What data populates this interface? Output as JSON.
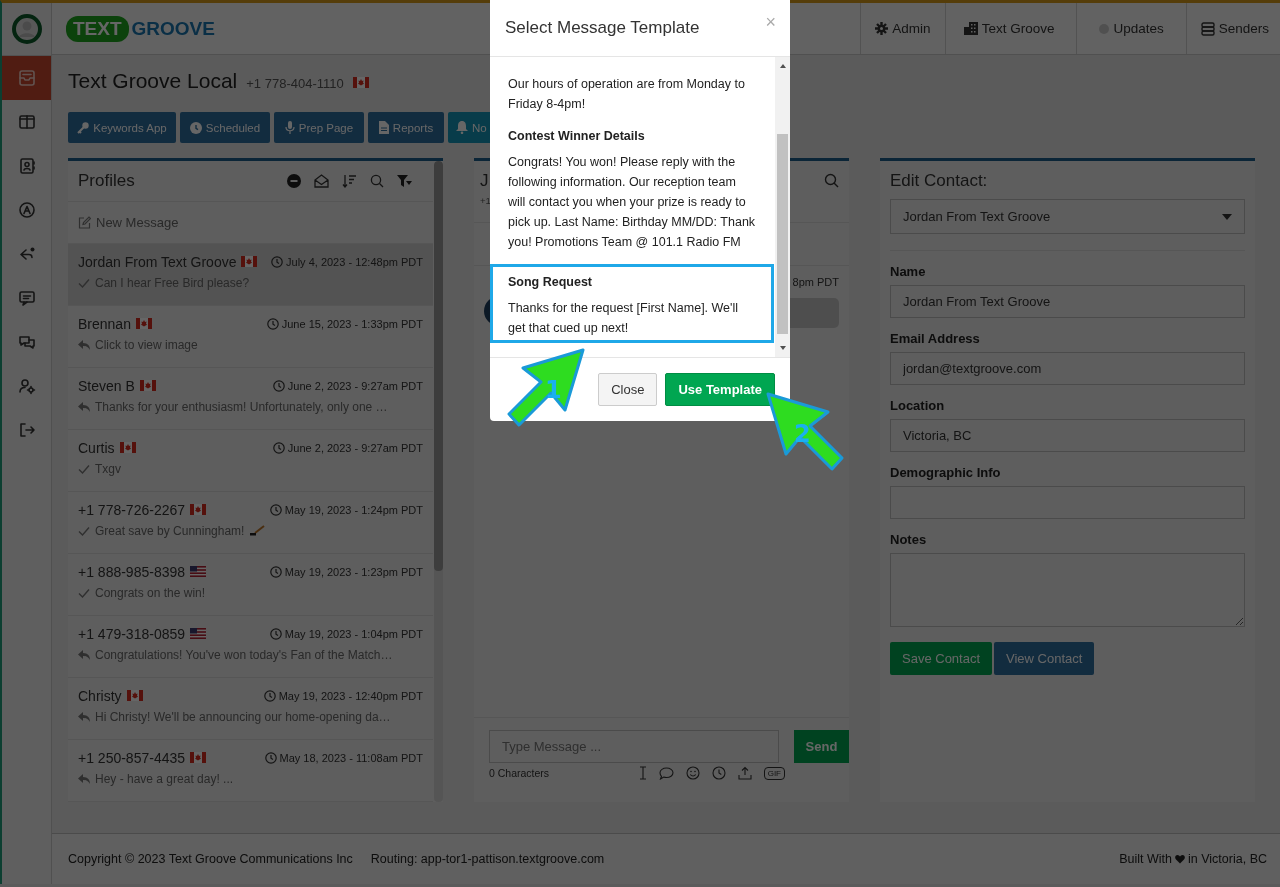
{
  "header": {
    "logo_badge": "TEXT",
    "logo_word": "GROOVE",
    "nav": [
      {
        "label": "Admin",
        "kind": "gear"
      },
      {
        "label": "Text Groove",
        "kind": "building"
      },
      {
        "label": "Updates",
        "kind": "dot"
      },
      {
        "label": "Senders",
        "kind": "stack"
      }
    ]
  },
  "sidebar": {
    "items": [
      {
        "kind": "inbox",
        "selected": true
      },
      {
        "kind": "columns",
        "selected": false
      },
      {
        "kind": "contact",
        "selected": false
      },
      {
        "kind": "compass",
        "selected": false
      },
      {
        "kind": "share",
        "selected": false
      },
      {
        "kind": "chat",
        "selected": false
      },
      {
        "kind": "chats",
        "selected": false
      },
      {
        "kind": "usergear",
        "selected": false
      },
      {
        "kind": "logout",
        "selected": false
      }
    ]
  },
  "page": {
    "title": "Text Groove Local",
    "phone": "+1 778-404-1110",
    "flag": {
      "kind": "ca"
    }
  },
  "toolbar": [
    {
      "label": "Keywords App",
      "kind": "key"
    },
    {
      "label": "Scheduled",
      "kind": "clock"
    },
    {
      "label": "Prep Page",
      "kind": "mic"
    },
    {
      "label": "Reports",
      "kind": "doc"
    },
    {
      "label": "No",
      "kind": "bell"
    }
  ],
  "profiles": {
    "title": "Profiles",
    "new_message": "New Message",
    "items": [
      {
        "name": "Jordan From Text Groove",
        "flag": {
          "kind": "ca"
        },
        "time": "July 4, 2023 - 12:48pm PDT",
        "status": {
          "kind": "sent"
        },
        "preview": "Can I hear Free Bird please?",
        "has_emoji": false,
        "selected": true
      },
      {
        "name": "Brennan",
        "flag": {
          "kind": "ca"
        },
        "time": "June 15, 2023 - 1:33pm PDT",
        "status": {
          "kind": "replied"
        },
        "preview": "Click to view image",
        "has_emoji": false,
        "selected": false
      },
      {
        "name": "Steven B",
        "flag": {
          "kind": "ca"
        },
        "time": "June 2, 2023 - 9:27am PDT",
        "status": {
          "kind": "replied"
        },
        "preview": "Thanks for your enthusiasm! Unfortunately, only one …",
        "has_emoji": false,
        "selected": false
      },
      {
        "name": "Curtis",
        "flag": {
          "kind": "ca"
        },
        "time": "June 2, 2023 - 9:27am PDT",
        "status": {
          "kind": "sent"
        },
        "preview": "Txgv",
        "has_emoji": false,
        "selected": false
      },
      {
        "name": "+1 778-726-2267",
        "flag": {
          "kind": "ca"
        },
        "time": "May 19, 2023 - 1:24pm PDT",
        "status": {
          "kind": "sent"
        },
        "preview": "Great save by Cunningham!",
        "has_emoji": true,
        "selected": false
      },
      {
        "name": "+1 888-985-8398",
        "flag": {
          "kind": "us"
        },
        "time": "May 19, 2023 - 1:23pm PDT",
        "status": {
          "kind": "sent"
        },
        "preview": "Congrats on the win!",
        "has_emoji": false,
        "selected": false
      },
      {
        "name": "+1 479-318-0859",
        "flag": {
          "kind": "us"
        },
        "time": "May 19, 2023 - 1:04pm PDT",
        "status": {
          "kind": "replied"
        },
        "preview": "Congratulations! You've won today's Fan of the Match…",
        "has_emoji": false,
        "selected": false
      },
      {
        "name": "Christy",
        "flag": {
          "kind": "ca"
        },
        "time": "May 19, 2023 - 12:40pm PDT",
        "status": {
          "kind": "replied"
        },
        "preview": "Hi Christy! We'll be announcing our home-opening da…",
        "has_emoji": false,
        "selected": false
      },
      {
        "name": "+1 250-857-4435",
        "flag": {
          "kind": "ca"
        },
        "time": "May 18, 2023 - 11:08am PDT",
        "status": {
          "kind": "replied"
        },
        "preview": "Hey - have a great day! ...",
        "has_emoji": false,
        "selected": false
      }
    ]
  },
  "conversation": {
    "title": "J",
    "subtitle": "+1",
    "message_time": "8pm PDT",
    "compose": {
      "placeholder": "Type Message ...",
      "send": "Send",
      "count": "0 Characters",
      "gif": "GIF"
    }
  },
  "contact": {
    "title": "Edit Contact:",
    "select_value": "Jordan From Text Groove",
    "fields": [
      {
        "label": "Name",
        "kind": "input",
        "value": "Jordan From Text Groove"
      },
      {
        "label": "Email Address",
        "kind": "input",
        "value": "jordan@textgroove.com"
      },
      {
        "label": "Location",
        "kind": "input",
        "value": "Victoria, BC"
      },
      {
        "label": "Demographic Info",
        "kind": "input"
      },
      {
        "label": "Notes",
        "kind": "textarea"
      }
    ],
    "buttons": [
      {
        "label": "Save Contact"
      },
      {
        "label": "View Contact"
      }
    ]
  },
  "footer": {
    "copyright": "Copyright © 2023 Text Groove Communications Inc",
    "routing": "Routing: app-tor1-pattison.textgroove.com",
    "built_with": "Built With",
    "location": "in Victoria, BC"
  },
  "modal": {
    "title": "Select Message Template",
    "close": "×",
    "templates": [
      {
        "body": "Our hours of operation are from Monday to Friday 8-4pm!",
        "selected": false
      },
      {
        "title": "Contest Winner Details",
        "body": "Congrats! You won! Please reply with the following information. Our reception team will contact you when your prize is ready to pick up. Last Name: Birthday MM/DD: Thank you! Promotions Team @ 101.1 Radio FM",
        "selected": false
      },
      {
        "title": "Song Request",
        "body": "Thanks for the request [First Name]. We'll get that cued up next!",
        "selected": true
      }
    ],
    "buttons": [
      {
        "label": "Close",
        "kind": "secondary"
      },
      {
        "label": "Use Template",
        "kind": "primary"
      }
    ]
  },
  "callouts": [
    {
      "label": "1"
    },
    {
      "label": "2"
    }
  ]
}
